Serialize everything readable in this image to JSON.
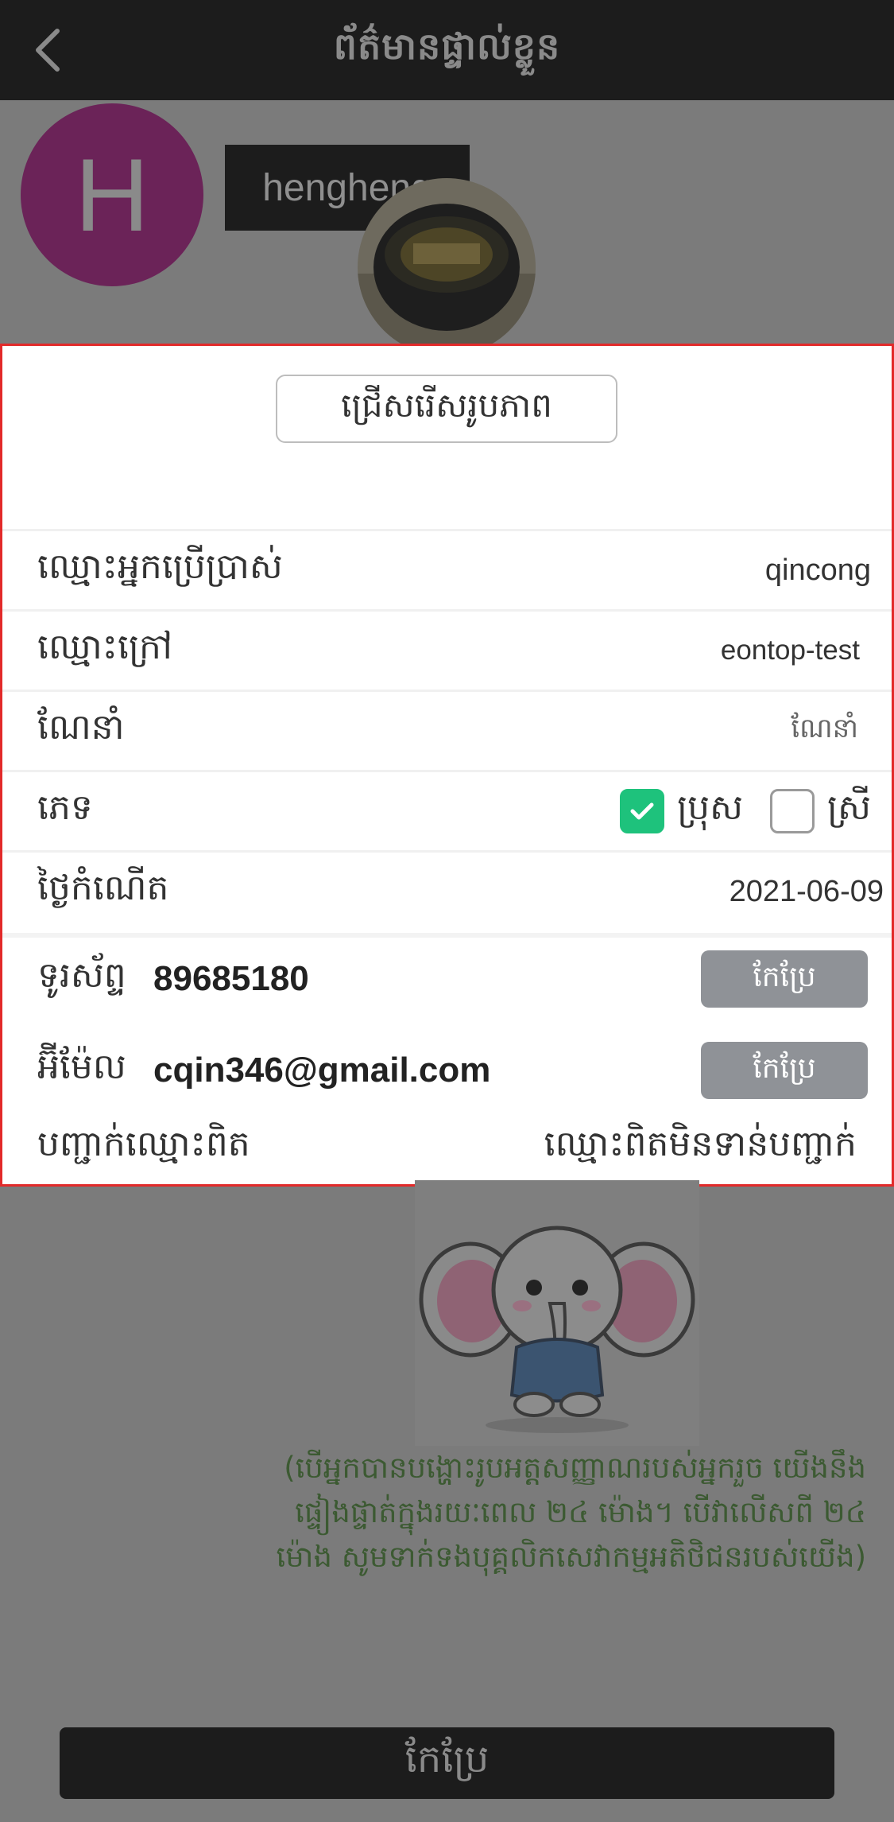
{
  "header": {
    "title": "ព័ត៌មានផ្ទាល់ខ្លួន",
    "back_icon": "chevron-left-icon"
  },
  "profile": {
    "avatar_letter": "H",
    "avatar_color": "#6b2358",
    "nickname_tooltip": "hengheng"
  },
  "panel": {
    "choose_photo_label": "ជ្រើសរើសរូបភាព",
    "rows": {
      "username": {
        "label": "ឈ្មោះអ្នកប្រើប្រាស់",
        "value": "qincong"
      },
      "nickname": {
        "label": "ឈ្មោះក្រៅ",
        "value": "eontop-test"
      },
      "referrer": {
        "label": "ណែនាំ",
        "value": "ណែនាំ"
      },
      "gender": {
        "label": "ភេទ",
        "male_label": "ប្រុស",
        "female_label": "ស្រី",
        "selected": "male"
      },
      "birthday": {
        "label": "ថ្ងៃកំណើត",
        "value": "2021-06-09"
      }
    },
    "phone": {
      "label": "ទូរស័ព្ទ",
      "value": "89685180",
      "edit_label": "កែប្រែ"
    },
    "email": {
      "label": "អ៊ីម៉ែល",
      "value": "cqin346@gmail.com",
      "edit_label": "កែប្រែ"
    },
    "verify": {
      "label": "បញ្ជាក់ឈ្មោះពិត",
      "status": "ឈ្មោះពិតមិនទាន់បញ្ជាក់"
    }
  },
  "notice": "(បើអ្នកបានបង្ហោះរូបអត្តសញ្ញាណរបស់អ្នករួច យើងនឹងផ្ទៀងផ្ទាត់ក្នុងរយៈពេល ២៤ ម៉ោង។ បើវាលើសពី ២៤ ម៉ោង សូមទាក់ទងបុគ្គលិកសេវាកម្មអតិថិជនរបស់យើង)",
  "submit_label": "កែប្រែ",
  "colors": {
    "accent_check": "#1ec27c",
    "panel_border": "#e22a2a",
    "edit_button": "#8f9297",
    "notice_text": "#3c5a32"
  }
}
